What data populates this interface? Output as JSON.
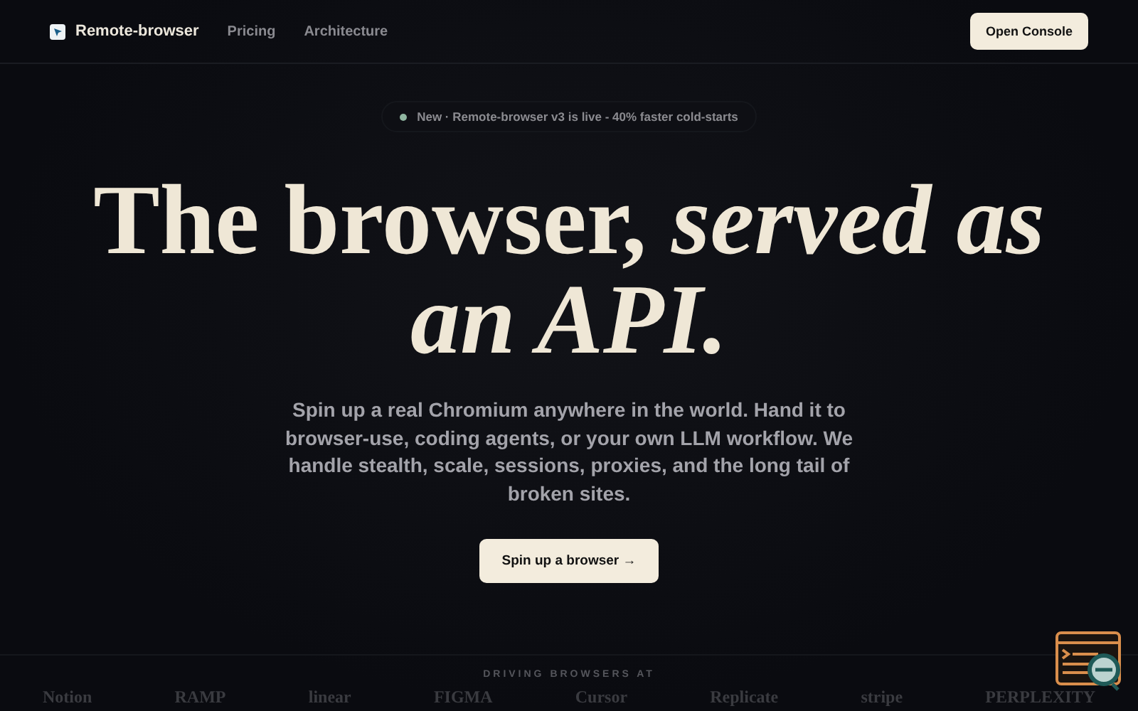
{
  "nav": {
    "brand": "Remote-browser",
    "links": [
      "Pricing",
      "Architecture"
    ],
    "cta": "Open Console"
  },
  "announcement": {
    "text": "New · Remote-browser v3 is live - 40% faster cold-starts"
  },
  "hero": {
    "headline": "The browser, *served as an API.*",
    "lead": "Spin up a real Chromium anywhere in the world. Hand it to browser-use, coding agents, or your own LLM workflow. We handle stealth, scale, sessions, proxies, and the long tail of broken sites.",
    "button": "Spin up a browser →"
  },
  "logos": {
    "heading": "DRIVING BROWSERS AT",
    "items": [
      "Notion",
      "RAMP",
      "linear",
      "FIGMA",
      "Cursor",
      "Replicate",
      "stripe",
      "PERPLEXITY"
    ]
  }
}
